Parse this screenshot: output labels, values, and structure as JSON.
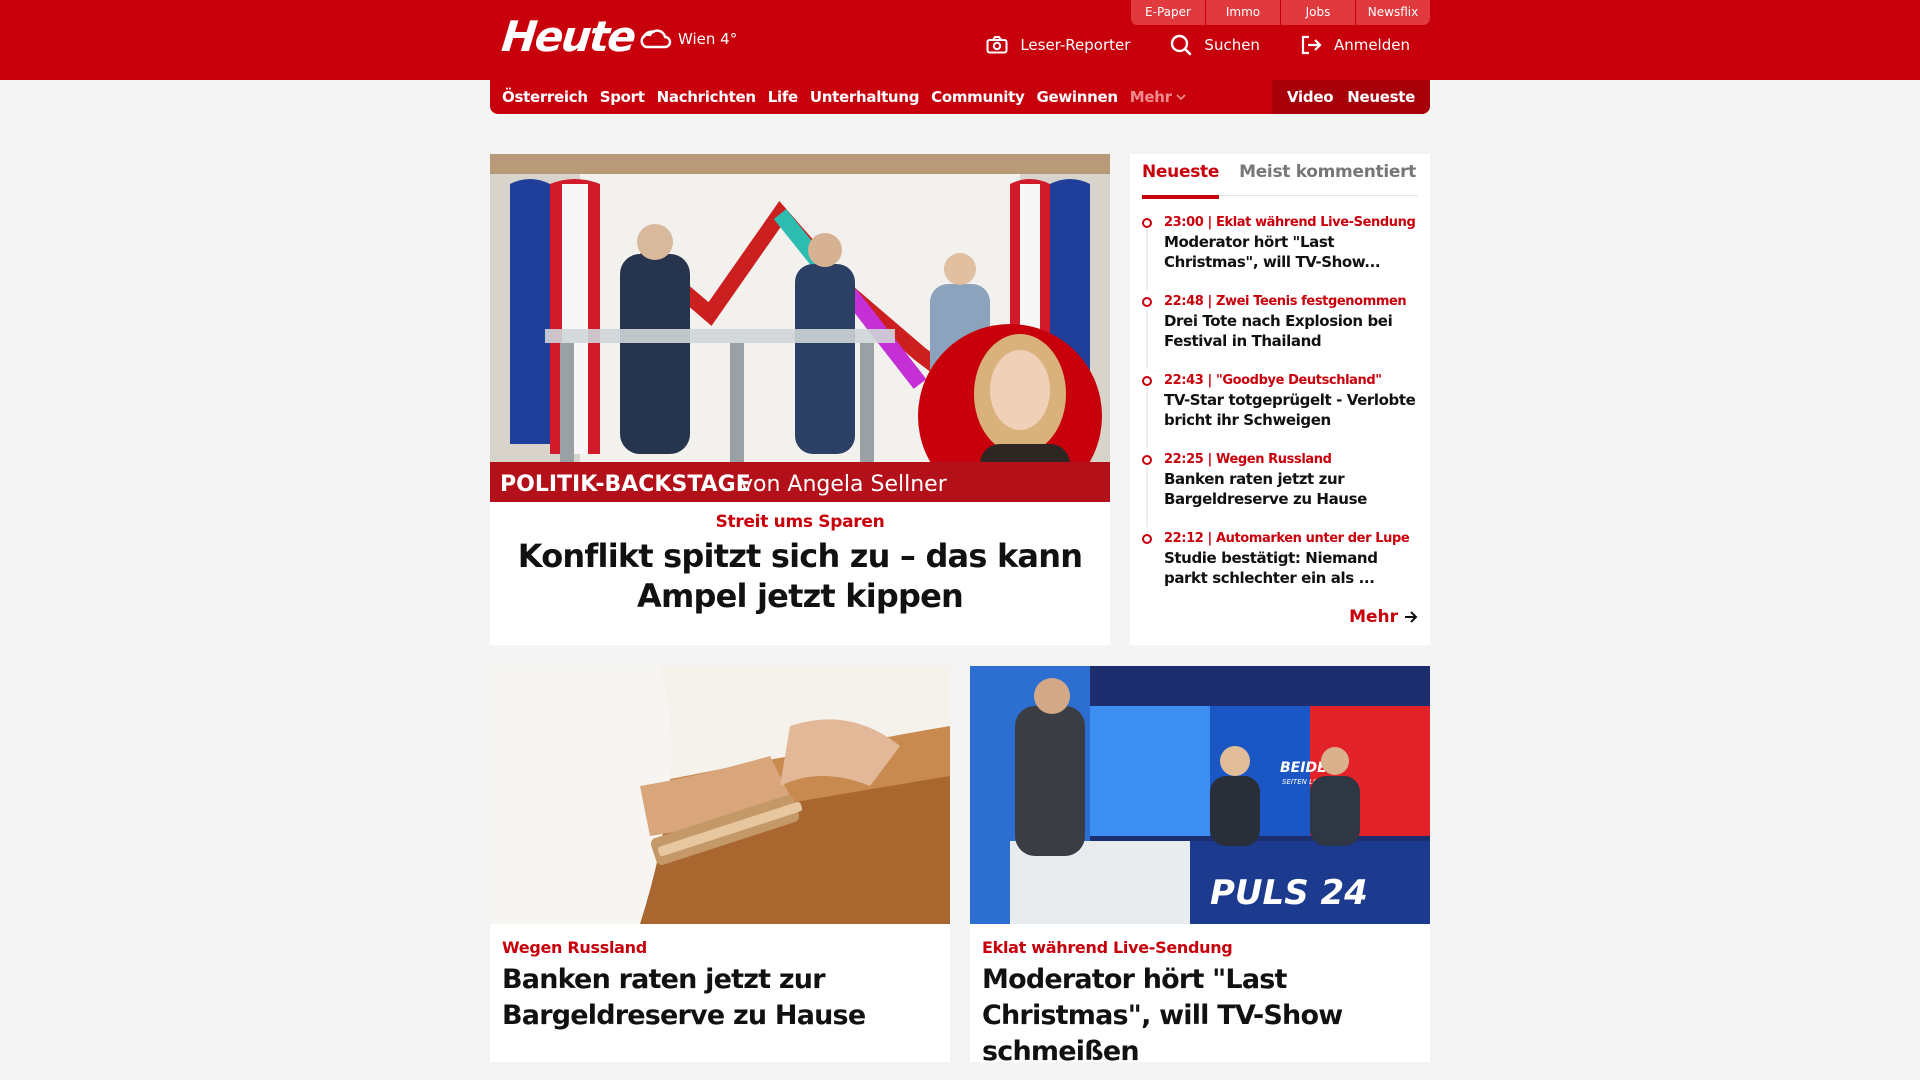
{
  "header": {
    "logo": "Heute",
    "weather": "Wien 4°",
    "service_links": [
      "E-Paper",
      "Immo",
      "Jobs",
      "Newsflix"
    ],
    "actions": {
      "reporter": "Leser-Reporter",
      "search": "Suchen",
      "login": "Anmelden"
    }
  },
  "nav": {
    "items": [
      "Österreich",
      "Sport",
      "Nachrichten",
      "Life",
      "Unterhaltung",
      "Community",
      "Gewinnen"
    ],
    "more": "Mehr",
    "video": "Video",
    "latest": "Neueste"
  },
  "hero": {
    "banner_main": "POLITIK-BACKSTAGE",
    "banner_author": "von Angela Sellner",
    "kicker": "Streit ums Sparen",
    "title": "Konflikt spitzt sich zu – das kann Ampel jetzt kippen"
  },
  "sidebar": {
    "tabs": [
      "Neueste",
      "Meist kommentiert"
    ],
    "items": [
      {
        "meta": "23:00 | Eklat während Live-Sendung",
        "title": "Moderator hört \"Last Christmas\", will TV-Show..."
      },
      {
        "meta": "22:48 | Zwei Teenis festgenommen",
        "title": "Drei Tote nach Explosion bei Festival in Thailand"
      },
      {
        "meta": "22:43 | \"Goodbye Deutschland\"",
        "title": "TV-Star totgeprügelt - Verlobte bricht ihr Schweigen"
      },
      {
        "meta": "22:25 | Wegen Russland",
        "title": "Banken raten jetzt zur Bargeldreserve zu Hause"
      },
      {
        "meta": "22:12 | Automarken unter der Lupe",
        "title": "Studie bestätigt: Niemand parkt schlechter ein als ..."
      }
    ],
    "more": "Mehr"
  },
  "cards": [
    {
      "kicker": "Wegen Russland",
      "title": "Banken raten jetzt zur Bargeldreserve zu Hause"
    },
    {
      "kicker": "Eklat während Live-Sendung",
      "title": "Moderator hört \"Last Christmas\", will TV-Show schmeißen"
    }
  ],
  "card_images": {
    "studio_brand": "PULS 24",
    "studio_sign": "BEIDE",
    "studio_sign_sub": "SEITEN LIVE"
  },
  "colors": {
    "brand": "#c8000b",
    "background": "#f4f4f4"
  }
}
